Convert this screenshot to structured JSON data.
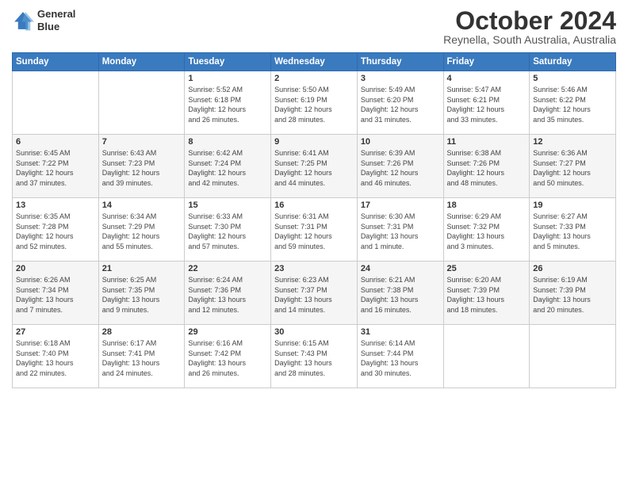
{
  "header": {
    "logo_line1": "General",
    "logo_line2": "Blue",
    "month_title": "October 2024",
    "subtitle": "Reynella, South Australia, Australia"
  },
  "days_of_week": [
    "Sunday",
    "Monday",
    "Tuesday",
    "Wednesday",
    "Thursday",
    "Friday",
    "Saturday"
  ],
  "weeks": [
    [
      {
        "day": "",
        "info": ""
      },
      {
        "day": "",
        "info": ""
      },
      {
        "day": "1",
        "info": "Sunrise: 5:52 AM\nSunset: 6:18 PM\nDaylight: 12 hours\nand 26 minutes."
      },
      {
        "day": "2",
        "info": "Sunrise: 5:50 AM\nSunset: 6:19 PM\nDaylight: 12 hours\nand 28 minutes."
      },
      {
        "day": "3",
        "info": "Sunrise: 5:49 AM\nSunset: 6:20 PM\nDaylight: 12 hours\nand 31 minutes."
      },
      {
        "day": "4",
        "info": "Sunrise: 5:47 AM\nSunset: 6:21 PM\nDaylight: 12 hours\nand 33 minutes."
      },
      {
        "day": "5",
        "info": "Sunrise: 5:46 AM\nSunset: 6:22 PM\nDaylight: 12 hours\nand 35 minutes."
      }
    ],
    [
      {
        "day": "6",
        "info": "Sunrise: 6:45 AM\nSunset: 7:22 PM\nDaylight: 12 hours\nand 37 minutes."
      },
      {
        "day": "7",
        "info": "Sunrise: 6:43 AM\nSunset: 7:23 PM\nDaylight: 12 hours\nand 39 minutes."
      },
      {
        "day": "8",
        "info": "Sunrise: 6:42 AM\nSunset: 7:24 PM\nDaylight: 12 hours\nand 42 minutes."
      },
      {
        "day": "9",
        "info": "Sunrise: 6:41 AM\nSunset: 7:25 PM\nDaylight: 12 hours\nand 44 minutes."
      },
      {
        "day": "10",
        "info": "Sunrise: 6:39 AM\nSunset: 7:26 PM\nDaylight: 12 hours\nand 46 minutes."
      },
      {
        "day": "11",
        "info": "Sunrise: 6:38 AM\nSunset: 7:26 PM\nDaylight: 12 hours\nand 48 minutes."
      },
      {
        "day": "12",
        "info": "Sunrise: 6:36 AM\nSunset: 7:27 PM\nDaylight: 12 hours\nand 50 minutes."
      }
    ],
    [
      {
        "day": "13",
        "info": "Sunrise: 6:35 AM\nSunset: 7:28 PM\nDaylight: 12 hours\nand 52 minutes."
      },
      {
        "day": "14",
        "info": "Sunrise: 6:34 AM\nSunset: 7:29 PM\nDaylight: 12 hours\nand 55 minutes."
      },
      {
        "day": "15",
        "info": "Sunrise: 6:33 AM\nSunset: 7:30 PM\nDaylight: 12 hours\nand 57 minutes."
      },
      {
        "day": "16",
        "info": "Sunrise: 6:31 AM\nSunset: 7:31 PM\nDaylight: 12 hours\nand 59 minutes."
      },
      {
        "day": "17",
        "info": "Sunrise: 6:30 AM\nSunset: 7:31 PM\nDaylight: 13 hours\nand 1 minute."
      },
      {
        "day": "18",
        "info": "Sunrise: 6:29 AM\nSunset: 7:32 PM\nDaylight: 13 hours\nand 3 minutes."
      },
      {
        "day": "19",
        "info": "Sunrise: 6:27 AM\nSunset: 7:33 PM\nDaylight: 13 hours\nand 5 minutes."
      }
    ],
    [
      {
        "day": "20",
        "info": "Sunrise: 6:26 AM\nSunset: 7:34 PM\nDaylight: 13 hours\nand 7 minutes."
      },
      {
        "day": "21",
        "info": "Sunrise: 6:25 AM\nSunset: 7:35 PM\nDaylight: 13 hours\nand 9 minutes."
      },
      {
        "day": "22",
        "info": "Sunrise: 6:24 AM\nSunset: 7:36 PM\nDaylight: 13 hours\nand 12 minutes."
      },
      {
        "day": "23",
        "info": "Sunrise: 6:23 AM\nSunset: 7:37 PM\nDaylight: 13 hours\nand 14 minutes."
      },
      {
        "day": "24",
        "info": "Sunrise: 6:21 AM\nSunset: 7:38 PM\nDaylight: 13 hours\nand 16 minutes."
      },
      {
        "day": "25",
        "info": "Sunrise: 6:20 AM\nSunset: 7:39 PM\nDaylight: 13 hours\nand 18 minutes."
      },
      {
        "day": "26",
        "info": "Sunrise: 6:19 AM\nSunset: 7:39 PM\nDaylight: 13 hours\nand 20 minutes."
      }
    ],
    [
      {
        "day": "27",
        "info": "Sunrise: 6:18 AM\nSunset: 7:40 PM\nDaylight: 13 hours\nand 22 minutes."
      },
      {
        "day": "28",
        "info": "Sunrise: 6:17 AM\nSunset: 7:41 PM\nDaylight: 13 hours\nand 24 minutes."
      },
      {
        "day": "29",
        "info": "Sunrise: 6:16 AM\nSunset: 7:42 PM\nDaylight: 13 hours\nand 26 minutes."
      },
      {
        "day": "30",
        "info": "Sunrise: 6:15 AM\nSunset: 7:43 PM\nDaylight: 13 hours\nand 28 minutes."
      },
      {
        "day": "31",
        "info": "Sunrise: 6:14 AM\nSunset: 7:44 PM\nDaylight: 13 hours\nand 30 minutes."
      },
      {
        "day": "",
        "info": ""
      },
      {
        "day": "",
        "info": ""
      }
    ]
  ]
}
